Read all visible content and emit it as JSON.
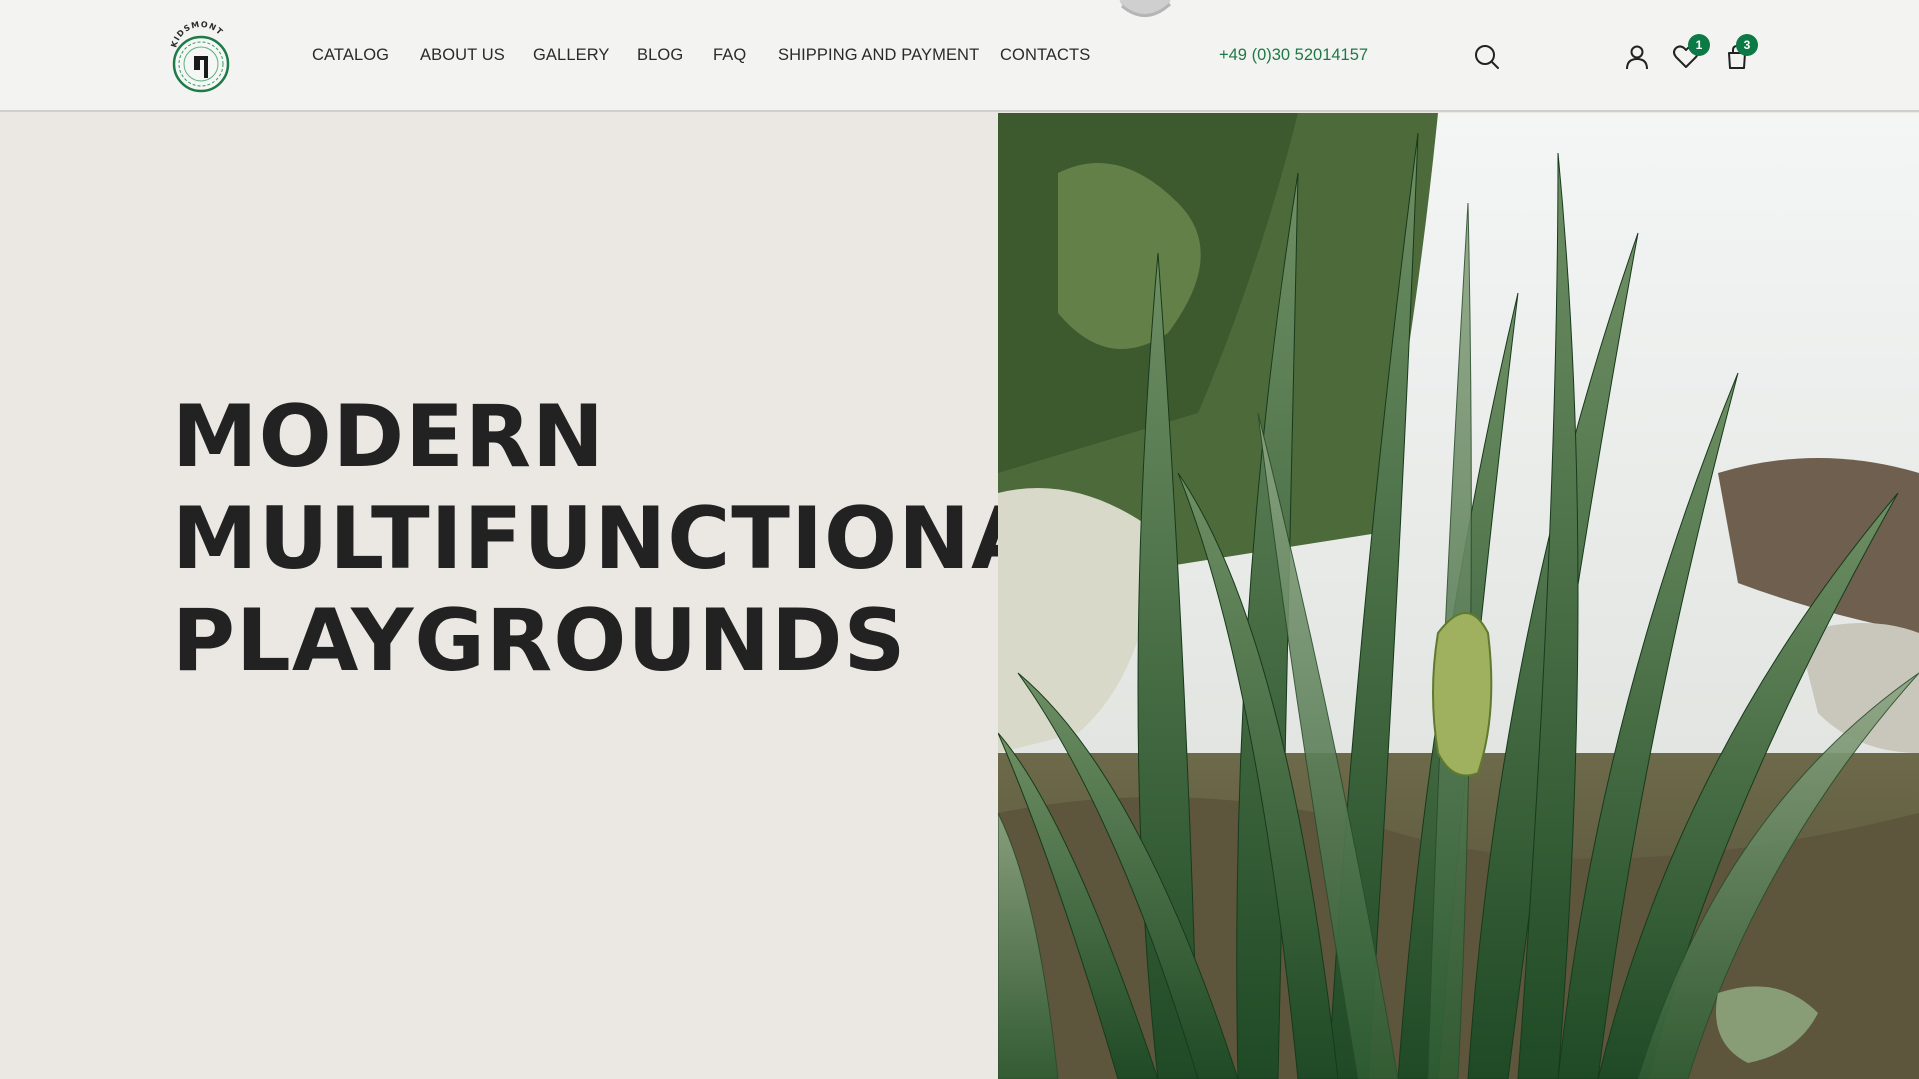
{
  "brand": {
    "logo_text": "KIDSMONT",
    "logo_icon": "tree-ring-logo-icon"
  },
  "nav": {
    "items": [
      {
        "label": "CATALOG"
      },
      {
        "label": "ABOUT US"
      },
      {
        "label": "GALLERY"
      },
      {
        "label": "BLOG"
      },
      {
        "label": "FAQ"
      },
      {
        "label": "SHIPPING AND PAYMENT"
      },
      {
        "label": "CONTACTS"
      }
    ]
  },
  "header": {
    "phone": "+49 (0)30 52014157",
    "icons": {
      "search": "search-icon",
      "account": "user-icon",
      "wishlist": "heart-icon",
      "cart": "shopping-bag-icon"
    },
    "wishlist_count": "1",
    "cart_count": "3"
  },
  "hero": {
    "title_lines": [
      "MODERN",
      "MULTIFUNCTIONAL",
      "PLAYGROUNDS"
    ],
    "image_alt": "daffodil-plants-video"
  },
  "colors": {
    "accent": "#0b7a44",
    "phone": "#1e7a45",
    "hero_bg": "#ebe8e4",
    "header_bg": "#f3f3f2",
    "text": "#222222"
  }
}
